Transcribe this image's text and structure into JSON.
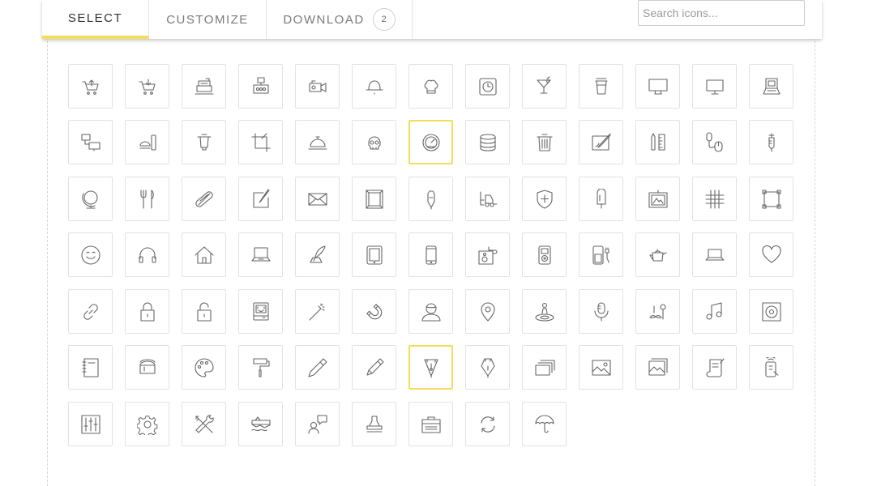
{
  "tabs": [
    {
      "label": "SELECT",
      "active": true
    },
    {
      "label": "CUSTOMIZE",
      "active": false
    },
    {
      "label": "DOWNLOAD",
      "active": false
    }
  ],
  "download_badge": "2",
  "search": {
    "placeholder": "Search icons..."
  },
  "accent_color": "#f5dd5b",
  "icons": [
    [
      "cart-upload",
      "cart-download",
      "cash-register",
      "abacus",
      "camcorder",
      "bowler-hat",
      "chef-hat",
      "clock",
      "cocktail",
      "coffee-cup",
      "desktop-monitor",
      "monitor",
      "retro-computer"
    ],
    [
      "networked-computers",
      "burger-phone",
      "cooking-pot",
      "crop-tool",
      "desk-bell",
      "skull",
      "speedometer",
      "database",
      "trash-can",
      "drawing-tablet",
      "pencil-ruler",
      "computer-mouse",
      "syringe"
    ],
    [
      "globe",
      "fork-knife",
      "hot-dog",
      "note-pencil",
      "envelope",
      "frame",
      "pen-nib",
      "forklift",
      "shield-cross",
      "ice-pop",
      "painting-easel",
      "grid-hash",
      "selection-frame"
    ],
    [
      "smiley",
      "headphones",
      "house",
      "laptop",
      "quill-ink",
      "tablet",
      "smartphone",
      "cassette-speaker",
      "ipod",
      "phone-charger",
      "teapot",
      "laptop-small",
      "heart"
    ],
    [
      "link",
      "padlock-closed",
      "padlock-open",
      "retro-mac",
      "magic-wand",
      "magnet",
      "user",
      "map-pin",
      "location-person",
      "microphone",
      "mustache-monocle",
      "music-note",
      "speaker"
    ],
    [
      "notebook",
      "paint-bucket",
      "palette",
      "paint-roller",
      "pencil",
      "pen",
      "fountain-pen",
      "fountain-pen-alt",
      "photo-stack",
      "image",
      "image-gallery",
      "scroll-quill",
      "remote-tap"
    ],
    [
      "equalizer",
      "gear",
      "wrench-screwdriver",
      "shipwreck",
      "speech-user",
      "rubber-stamp",
      "briefcase",
      "refresh",
      "umbrella"
    ]
  ],
  "selected_icons": [
    "speedometer",
    "fountain-pen"
  ]
}
